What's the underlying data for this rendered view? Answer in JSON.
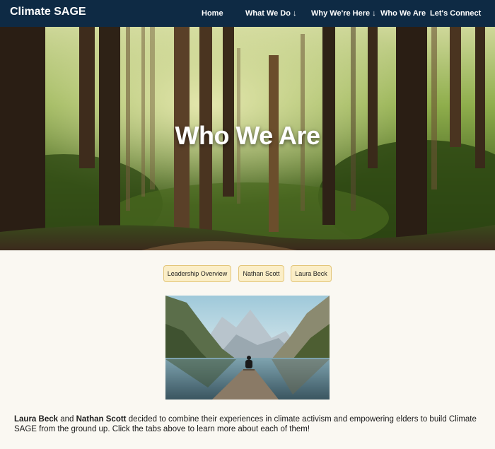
{
  "header": {
    "brand": "Climate SAGE",
    "nav": [
      {
        "label": "Home"
      },
      {
        "label": "What We Do ↓"
      },
      {
        "label": "Why We're Here ↓"
      },
      {
        "label": "Who We Are"
      },
      {
        "label": "Let's Connect"
      }
    ],
    "background_color": "#0e2a44"
  },
  "hero": {
    "title": "Who We Are",
    "image": "forest-image"
  },
  "tabs": [
    {
      "label": "Leadership Overview"
    },
    {
      "label": "Nathan Scott"
    },
    {
      "label": "Laura Beck"
    }
  ],
  "photo": {
    "image": "mountain-lake-image"
  },
  "content": {
    "name_1": "Laura Beck",
    "connector": " and ",
    "name_2": "Nathan Scott",
    "text": " decided to combine their experiences in climate activism and empowering elders to build Climate SAGE from the ground up. Click the tabs above to learn more about each of them!"
  },
  "colors": {
    "tab_background": "#fbeec7",
    "tab_border": "#e3c67a",
    "page_background": "#faf8f2"
  }
}
